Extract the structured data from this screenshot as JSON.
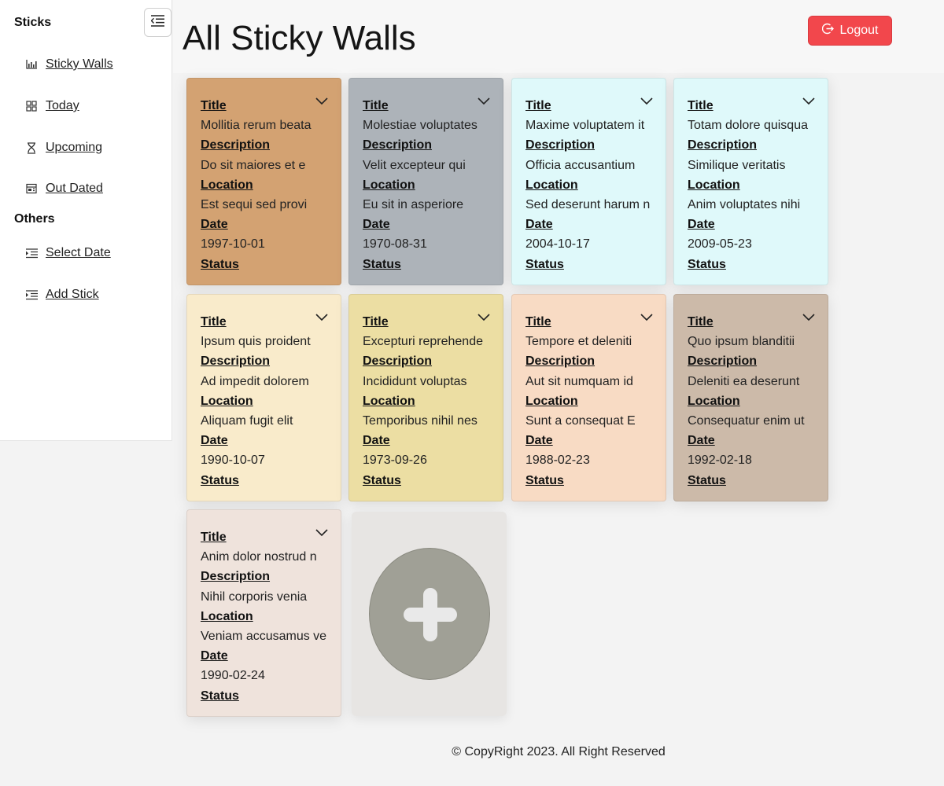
{
  "sidebar": {
    "sections": [
      {
        "title": "Sticks",
        "items": [
          {
            "label": "Sticky Walls",
            "icon": "bar-chart-icon"
          },
          {
            "label": "Today",
            "icon": "grid-icon"
          },
          {
            "label": "Upcoming",
            "icon": "hourglass-icon"
          },
          {
            "label": "Out Dated",
            "icon": "calendar-store-icon"
          }
        ]
      },
      {
        "title": "Others",
        "items": [
          {
            "label": "Select Date",
            "icon": "indent-icon"
          },
          {
            "label": "Add Stick",
            "icon": "indent-icon"
          }
        ]
      }
    ],
    "toggle_icon": "menu-indent-icon"
  },
  "header": {
    "title": "All Sticky Walls",
    "logout_label": "Logout",
    "logout_color": "#f2474c"
  },
  "labels": {
    "title": "Title",
    "description": "Description",
    "location": "Location",
    "date": "Date",
    "status": "Status"
  },
  "cards": [
    {
      "color": "#d3a272",
      "title": "Mollitia rerum beata",
      "description": "Do sit maiores et e",
      "location": "Est sequi sed provi",
      "date": "1997-10-01"
    },
    {
      "color": "#adb3b9",
      "title": "Molestiae voluptates",
      "description": "Velit excepteur qui",
      "location": "Eu sit in asperiore",
      "date": "1970-08-31"
    },
    {
      "color": "#dff9fa",
      "title": "Maxime voluptatem it",
      "description": "Officia accusantium",
      "location": "Sed deserunt harum n",
      "date": "2004-10-17"
    },
    {
      "color": "#dff9fa",
      "title": "Totam dolore quisqua",
      "description": "Similique veritatis",
      "location": "Anim voluptates nihi",
      "date": "2009-05-23"
    },
    {
      "color": "#f9ebcb",
      "title": "Ipsum quis proident",
      "description": "Ad impedit dolorem",
      "location": "Aliquam fugit elit",
      "date": "1990-10-07"
    },
    {
      "color": "#ecdea3",
      "title": "Excepturi reprehende",
      "description": "Incididunt voluptas",
      "location": "Temporibus nihil nes",
      "date": "1973-09-26"
    },
    {
      "color": "#f8dbc4",
      "title": "Tempore et deleniti",
      "description": "Aut sit numquam id",
      "location": "Sunt a consequat E",
      "date": "1988-02-23"
    },
    {
      "color": "#ccbaa9",
      "title": "Quo ipsum blanditii",
      "description": "Deleniti ea deserunt",
      "location": "Consequatur enim ut",
      "date": "1992-02-18"
    },
    {
      "color": "#efe3dc",
      "title": "Anim dolor nostrud n",
      "description": "Nihil corporis venia",
      "location": "Veniam accusamus ve",
      "date": "1990-02-24"
    }
  ],
  "add_card": {
    "icon": "plus-circle-icon"
  },
  "footer": {
    "text": "© CopyRight 2023. All Right Reserved"
  }
}
